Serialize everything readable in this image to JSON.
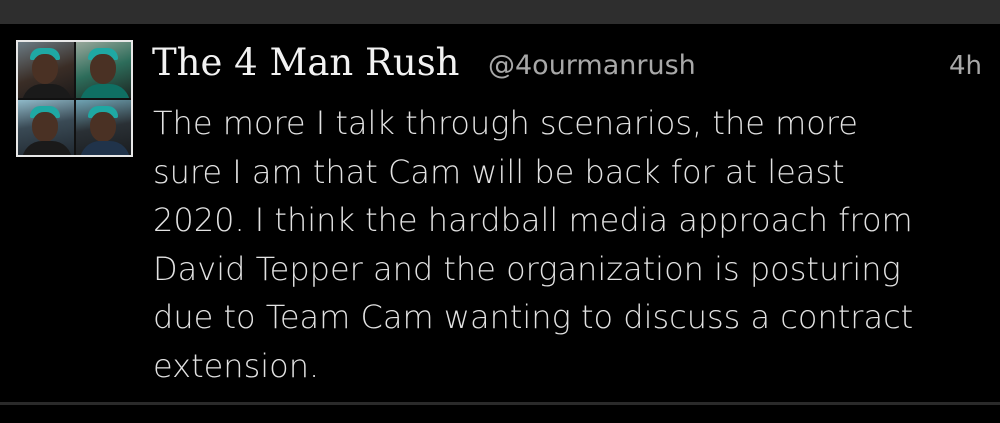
{
  "tweet": {
    "author_name": "The 4 Man Rush",
    "author_handle": "@4ourmanrush",
    "timestamp": "4h",
    "body": "The more I talk through scenarios, the more\nsure I am that Cam will be back for at least\n2020. I think the hardball media approach from\nDavid Tepper and the organization is posturing\ndue to Team Cam wanting to discuss a contract\nextension."
  },
  "colors": {
    "background": "#000000",
    "top_bar": "#2e2e2e",
    "name_text": "#f2f2f2",
    "secondary_text": "#a8a8a8",
    "body_text": "#e2e2e2",
    "divider": "#2a2a2a",
    "avatar_accent": "#1fa8a3"
  },
  "icons": {
    "avatar": "profile-photo-collage"
  }
}
